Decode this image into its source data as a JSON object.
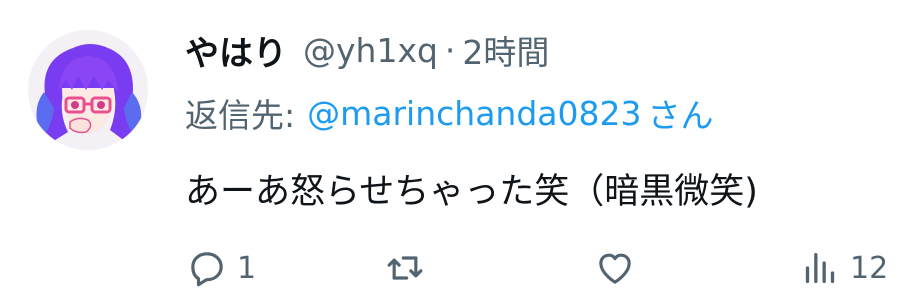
{
  "tweet": {
    "display_name": "やはり",
    "handle": "@yh1xq",
    "separator": "·",
    "time": "2時間",
    "reply_prefix": "返信先:",
    "reply_to": "@marinchanda0823",
    "reply_suffix": "さん",
    "text": "あーあ怒らせちゃった笑（暗黒微笑)"
  },
  "actions": {
    "reply_count": "1",
    "retweet_count": "",
    "like_count": "",
    "views_count": "12"
  },
  "icons": {
    "reply": "reply-icon",
    "retweet": "retweet-icon",
    "like": "heart-icon",
    "views": "views-icon"
  },
  "colors": {
    "text": "#0f1419",
    "secondary": "#536471",
    "link": "#1d9bf0",
    "avatar_hair": "#7a3cf0",
    "avatar_glasses": "#e8508f"
  }
}
